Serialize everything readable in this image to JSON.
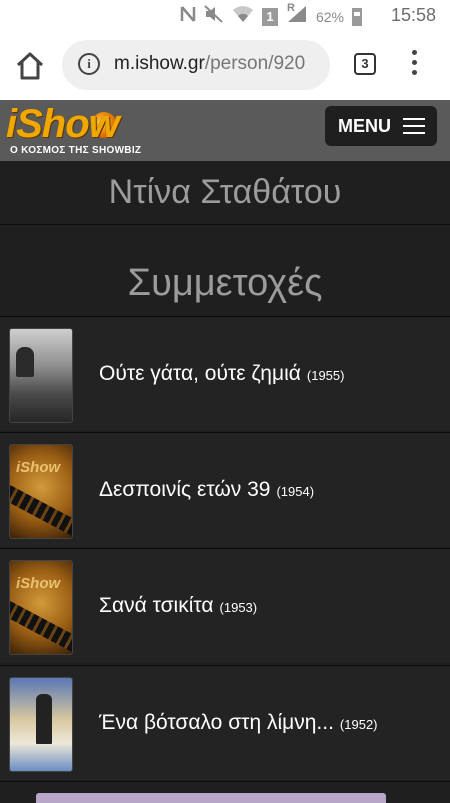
{
  "status_bar": {
    "battery_pct": "62%",
    "time": "15:58",
    "sim_indicator": "1",
    "network_type": "R",
    "icons": [
      "nfc-icon",
      "mute-icon",
      "wifi-icon",
      "sim-icon",
      "signal-icon",
      "battery-icon"
    ]
  },
  "browser": {
    "url_domain": "m.ishow.gr",
    "url_path": "/person/920",
    "tab_count": "3"
  },
  "site": {
    "brand": "iShow",
    "tagline": "Ο ΚΟΣΜΟΣ ΤΗΣ SHOWBIZ",
    "menu_label": "MENU"
  },
  "person": {
    "name": "Ντίνα Σταθάτου"
  },
  "section": {
    "title": "Συμμετοχές"
  },
  "films": [
    {
      "title": "Ούτε γάτα, ούτε ζημιά",
      "year": "(1955)"
    },
    {
      "title": "Δεσποινίς ετών 39",
      "year": "(1954)"
    },
    {
      "title": "Σανά τσικίτα",
      "year": "(1953)"
    },
    {
      "title": "Ένα βότσαλο στη λίμνη...",
      "year": "(1952)"
    }
  ],
  "colors": {
    "page_bg": "#1f1f1f",
    "header_bg": "#5a5a5a",
    "brand_orange": "#f0a700",
    "muted_text": "#9c9c9c"
  }
}
